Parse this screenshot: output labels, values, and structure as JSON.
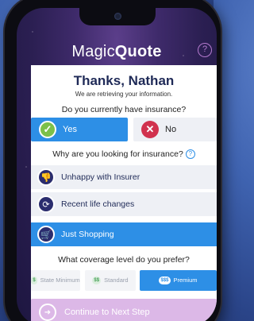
{
  "app": {
    "brand_part1": "Magic",
    "brand_part2": "Quote",
    "help_glyph": "?"
  },
  "header": {
    "title": "Thanks, Nathan",
    "subtitle": "We are retrieving your information."
  },
  "insurance_question": {
    "label": "Do you currently have insurance?",
    "yes_label": "Yes",
    "no_label": "No",
    "selected": "Yes"
  },
  "reason_question": {
    "label": "Why are you looking for insurance?",
    "help_glyph": "?",
    "options": [
      {
        "label": "Unhappy with Insurer",
        "icon": "thumbs-down-icon"
      },
      {
        "label": "Recent life changes",
        "icon": "refresh-icon"
      },
      {
        "label": "Just Shopping",
        "icon": "shopping-cart-icon"
      }
    ],
    "selected": "Just Shopping"
  },
  "coverage_question": {
    "label": "What coverage level do you prefer?",
    "options": [
      {
        "tag": "$",
        "label": "State Minimum"
      },
      {
        "tag": "$$",
        "label": "Standard"
      },
      {
        "tag": "$$$",
        "label": "Premium"
      }
    ],
    "selected": "Premium"
  },
  "footer": {
    "next_label": "Continue to Next Step"
  },
  "colors": {
    "accent_blue": "#2d8fe6",
    "title_navy": "#1f2a57",
    "yes_green": "#7cc04a",
    "no_red": "#d1324e",
    "next_pink": "#dcb8e7"
  }
}
